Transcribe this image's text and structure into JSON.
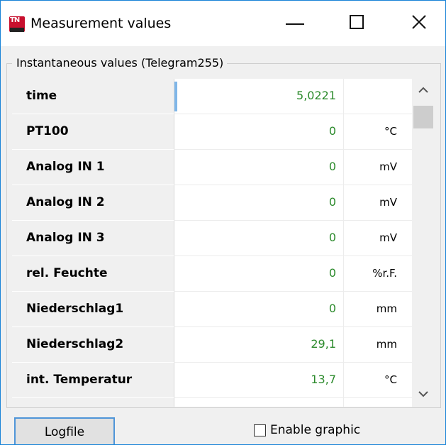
{
  "window": {
    "title": "Measurement values",
    "icon": "app-logo-icon",
    "controls": [
      "minimize-icon",
      "maximize-icon",
      "close-icon"
    ]
  },
  "group": {
    "label": "Instantaneous values (Telegram255)"
  },
  "rows": [
    {
      "name": "time",
      "value": "5,0221",
      "unit": ""
    },
    {
      "name": "PT100",
      "value": "0",
      "unit": "°C"
    },
    {
      "name": "Analog IN 1",
      "value": "0",
      "unit": "mV"
    },
    {
      "name": "Analog IN 2",
      "value": "0",
      "unit": "mV"
    },
    {
      "name": "Analog IN 3",
      "value": "0",
      "unit": "mV"
    },
    {
      "name": "rel. Feuchte",
      "value": "0",
      "unit": "%r.F."
    },
    {
      "name": "Niederschlag1",
      "value": "0",
      "unit": "mm"
    },
    {
      "name": "Niederschlag2",
      "value": "29,1",
      "unit": "mm"
    },
    {
      "name": "int. Temperatur",
      "value": "13,7",
      "unit": "°C"
    },
    {
      "name": "",
      "value": "",
      "unit": ""
    }
  ],
  "footer": {
    "logfile_label": "Logfile",
    "enable_graphic_label": "Enable graphic",
    "enable_graphic_checked": false
  },
  "colors": {
    "value_text": "#2b8a2b",
    "name_cell_bg": "#f0f0f0",
    "focus_accent": "#4f95d8",
    "window_border": "#1883d7"
  }
}
